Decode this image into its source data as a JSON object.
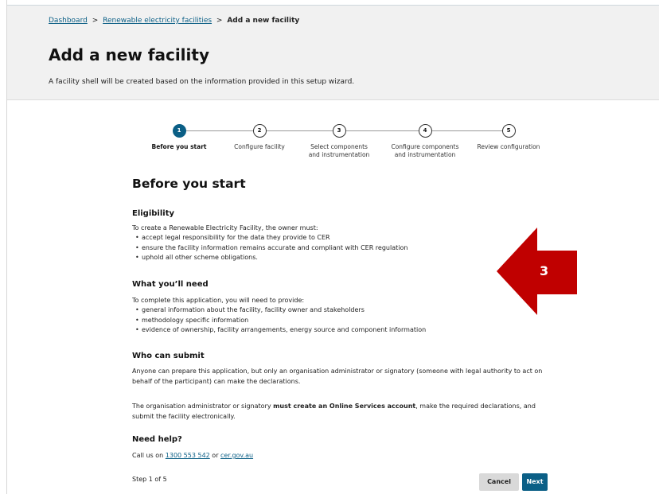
{
  "breadcrumb": {
    "items": [
      "Dashboard",
      "Renewable electricity facilities"
    ],
    "separator": ">",
    "current": "Add a new facility"
  },
  "header": {
    "title": "Add a new facility",
    "description": "A facility shell will be created based on the information provided in this setup wizard."
  },
  "stepper": {
    "steps": [
      {
        "number": "1",
        "label": "Before you start",
        "state": "active"
      },
      {
        "number": "2",
        "label": "Configure facility",
        "state": "upcoming"
      },
      {
        "number": "3",
        "label": "Select components and instrumentation",
        "state": "upcoming"
      },
      {
        "number": "4",
        "label": "Configure components and instrumentation",
        "state": "upcoming"
      },
      {
        "number": "5",
        "label": "Review configuration",
        "state": "upcoming"
      }
    ]
  },
  "content": {
    "heading": "Before you start",
    "eligibility": {
      "heading": "Eligibility",
      "intro": "To create a Renewable Electricity Facility, the owner must:",
      "items": [
        "accept legal responsibility for the data they provide to CER",
        "ensure the facility information remains accurate and compliant with CER regulation",
        "uphold all other scheme obligations."
      ]
    },
    "need": {
      "heading": "What you’ll need",
      "intro": "To complete this application, you will need to provide:",
      "items": [
        "general information about the facility, facility owner and stakeholders",
        "methodology specific information",
        "evidence of ownership, facility arrangements, energy source and component information"
      ]
    },
    "who": {
      "heading": "Who can submit",
      "para1": "Anyone can prepare this application, but only an organisation administrator or signatory (someone with legal authority to act on behalf of the participant) can make the declarations.",
      "para2_before": "The organisation administrator or signatory ",
      "para2_bold": "must create an Online Services account",
      "para2_after": ", make the required declarations, and submit the facility electronically."
    },
    "help": {
      "heading": "Need help?",
      "prefix": "Call us on ",
      "phone": "1300 553 542",
      "middle": " or ",
      "site": "cer.gov.au"
    },
    "step_counter": "Step 1 of 5"
  },
  "buttons": {
    "cancel": "Cancel",
    "next": "Next"
  },
  "annotation": {
    "number": "3",
    "color": "#c00000"
  },
  "colors": {
    "accent": "#0b5f86",
    "header_bg": "#f1f1f1",
    "cancel_bg": "#d9d9d9"
  }
}
